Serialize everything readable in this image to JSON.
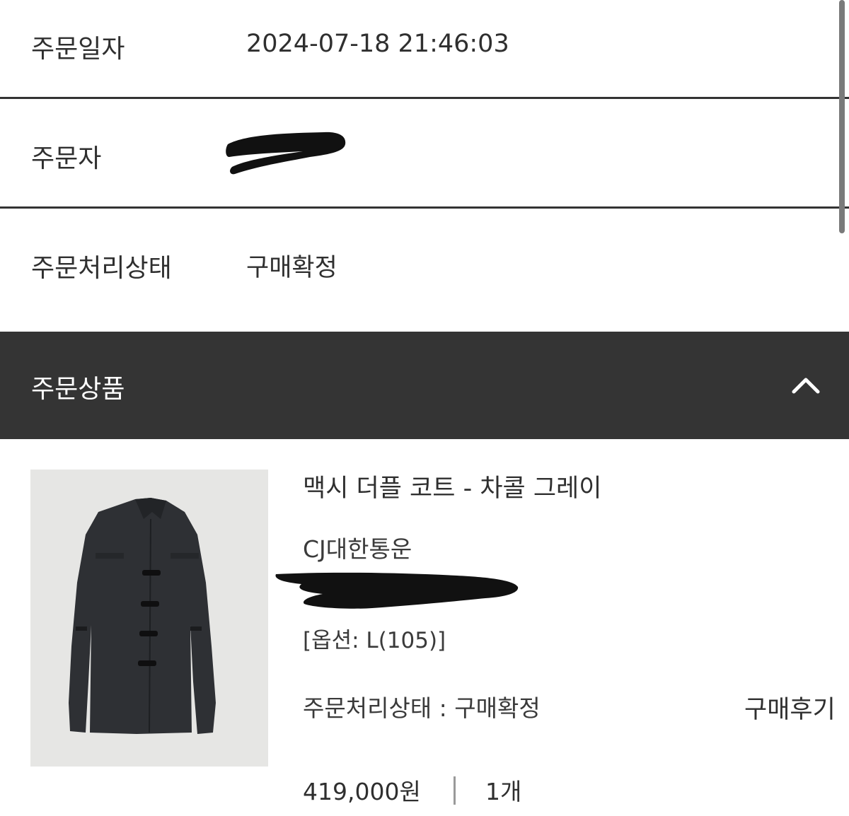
{
  "order_info": {
    "order_date": {
      "label": "주문일자",
      "value": "2024-07-18 21:46:03"
    },
    "orderer": {
      "label": "주문자"
    },
    "status": {
      "label": "주문처리상태",
      "value": "구매확정"
    }
  },
  "products_section": {
    "title": "주문상품",
    "toggle_icon": "chevron-up-icon"
  },
  "product": {
    "name": "맥시 더플 코트 - 차콜 그레이",
    "carrier": "CJ대한통운",
    "option": "[옵션: L(105)]",
    "status": "주문처리상태 : 구매확정",
    "review_label": "구매후기",
    "price": "419,000원",
    "separator": "|",
    "quantity": "1개",
    "image_icon": "coat-image"
  },
  "colors": {
    "header_bg": "#343434",
    "image_bg": "#e6e6e4",
    "divider": "#333333"
  }
}
